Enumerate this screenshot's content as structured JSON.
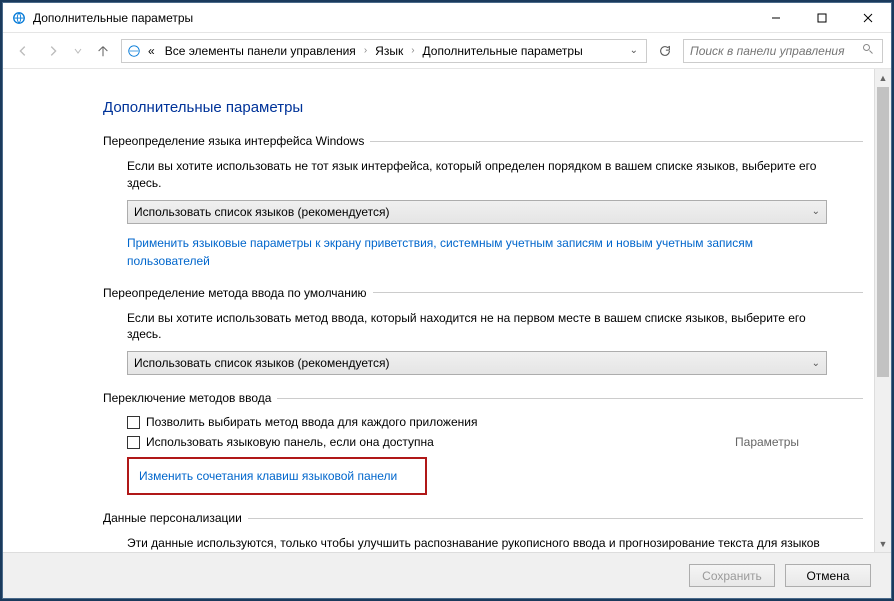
{
  "titlebar": {
    "title": "Дополнительные параметры"
  },
  "nav": {
    "crumbs_prefix": "«",
    "crumb1": "Все элементы панели управления",
    "crumb2": "Язык",
    "crumb3": "Дополнительные параметры",
    "search_placeholder": "Поиск в панели управления"
  },
  "page": {
    "heading": "Дополнительные параметры"
  },
  "group1": {
    "title": "Переопределение языка интерфейса Windows",
    "desc": "Если вы хотите использовать не тот язык интерфейса, который определен порядком в вашем списке языков, выберите его здесь.",
    "select_value": "Использовать список языков (рекомендуется)",
    "link": "Применить языковые параметры к экрану приветствия, системным учетным записям и новым учетным записям пользователей"
  },
  "group2": {
    "title": "Переопределение метода ввода по умолчанию",
    "desc": "Если вы хотите использовать метод ввода, который находится не на первом месте в вашем списке языков, выберите его здесь.",
    "select_value": "Использовать список языков (рекомендуется)"
  },
  "group3": {
    "title": "Переключение методов ввода",
    "cb1": "Позволить выбирать метод ввода для каждого приложения",
    "cb2": "Использовать языковую панель, если она доступна",
    "params_label": "Параметры",
    "link": "Изменить сочетания клавиш языковой панели"
  },
  "group4": {
    "title": "Данные персонализации",
    "desc": "Эти данные используются, только чтобы улучшить распознавание рукописного ввода и прогнозирование текста для языков без IME на этом компьютере. Никакая информация не отправляется в корпорацию Майкрософт."
  },
  "footer": {
    "save": "Сохранить",
    "cancel": "Отмена"
  }
}
